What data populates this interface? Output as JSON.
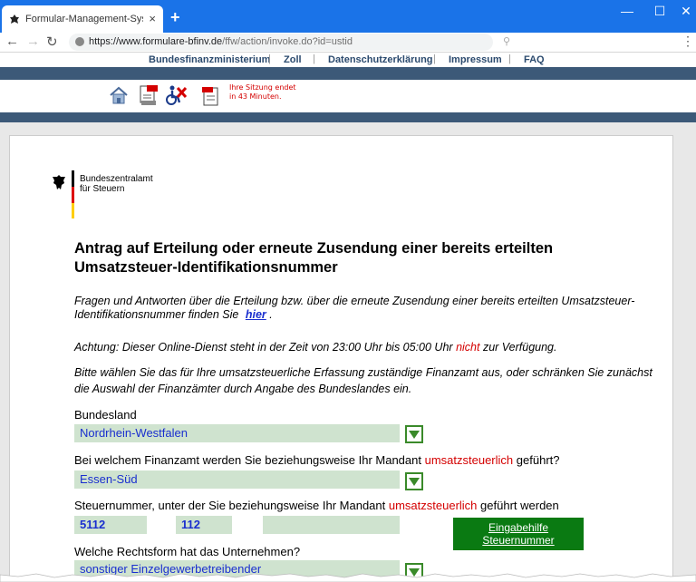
{
  "browser": {
    "tab_title": "Formular-Management-System d",
    "tab_close": "×",
    "new_tab": "+",
    "url_host": "https://www.formulare-bfinv.de",
    "url_path": "/ffw/action/invoke.do?id=ustid",
    "window_min": "—",
    "window_max": "☐",
    "window_close": "✕"
  },
  "site_nav": {
    "items": [
      "Bundesfinanzministerium",
      "Zoll",
      "Datenschutzerklärung",
      "Impressum",
      "FAQ"
    ],
    "separator": "|"
  },
  "session": {
    "line1": "Ihre Sitzung endet",
    "line2": "in 43 Minuten."
  },
  "logo": {
    "line1": "Bundeszentralamt",
    "line2": "für Steuern"
  },
  "page": {
    "title": "Antrag auf Erteilung oder erneute Zusendung einer bereits erteilten Umsatzsteuer-Identifikationsnummer",
    "intro_text": "Fragen und Antworten über die Erteilung bzw. über die erneute Zusendung einer bereits erteilten Umsatzsteuer-Identifikationsnummer finden Sie",
    "intro_link": "hier",
    "intro_end": ".",
    "warn_before": "Achtung: Dieser Online-Dienst steht in der Zeit von 23:00 Uhr bis 05:00 Uhr",
    "warn_red": "nicht",
    "warn_after": "zur Verfügung.",
    "select_hint": "Bitte wählen Sie das für Ihre umsatzsteuerliche Erfassung zuständige Finanzamt aus, oder schränken Sie zunächst die Auswahl der Finanzämter durch Angabe des Bundeslandes ein."
  },
  "form": {
    "bundesland_label": "Bundesland",
    "bundesland_value": "Nordrhein-Westfalen",
    "finanzamt_label_before": "Bei welchem Finanzamt werden Sie beziehungsweise Ihr Mandant",
    "finanzamt_label_red": "umsatzsteuerlich",
    "finanzamt_label_after": "geführt?",
    "finanzamt_value": "Essen-Süd",
    "steuernr_label_before": "Steuernummer, unter der Sie beziehungsweise Ihr Mandant",
    "steuernr_label_red": "umsatzsteuerlich",
    "steuernr_label_after": "geführt werden",
    "steuernr_part1": "5112",
    "steuernr_part2": "112",
    "steuernr_part3": "",
    "eingabehilfe_line1": "Eingabehilfe",
    "eingabehilfe_line2": "Steuernummer",
    "rechtsform_label": "Welche Rechtsform hat das Unternehmen?",
    "rechtsform_value": "sonstiger Einzelgewerbetreibender"
  },
  "colors": {
    "browser_blue": "#1a73e8",
    "header_bar": "#3c5978",
    "field_bg": "#cfe3cf",
    "field_text": "#1a2fcf",
    "button_green": "#0a7a12",
    "alert_red": "#d40000"
  }
}
